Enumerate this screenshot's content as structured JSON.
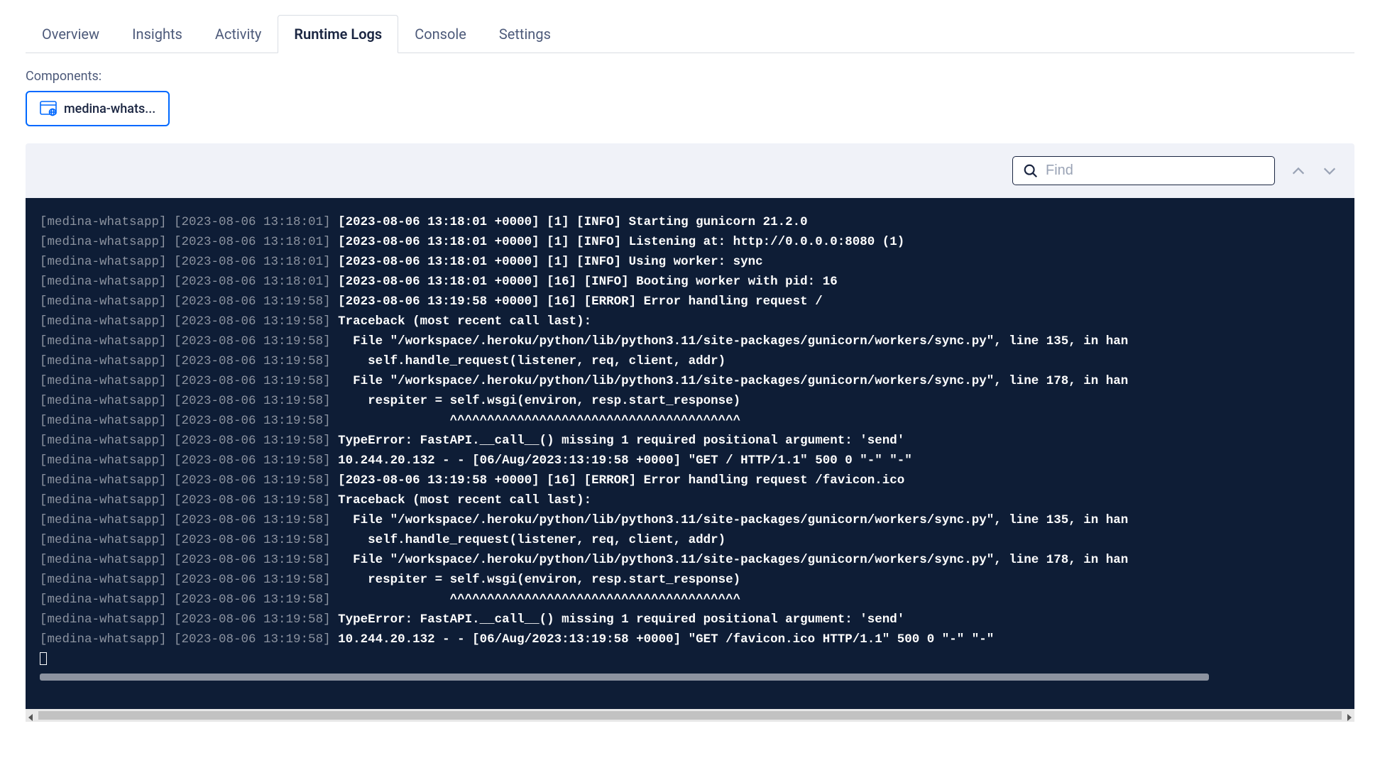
{
  "tabs": [
    {
      "label": "Overview",
      "active": false
    },
    {
      "label": "Insights",
      "active": false
    },
    {
      "label": "Activity",
      "active": false
    },
    {
      "label": "Runtime Logs",
      "active": true
    },
    {
      "label": "Console",
      "active": false
    },
    {
      "label": "Settings",
      "active": false
    }
  ],
  "components": {
    "label": "Components:",
    "selected": "medina-whats..."
  },
  "search": {
    "placeholder": "Find"
  },
  "logs": [
    {
      "prefix": "[medina-whatsapp]",
      "ts": "[2023-08-06 13:18:01]",
      "content": "[2023-08-06 13:18:01 +0000] [1] [INFO] Starting gunicorn 21.2.0"
    },
    {
      "prefix": "[medina-whatsapp]",
      "ts": "[2023-08-06 13:18:01]",
      "content": "[2023-08-06 13:18:01 +0000] [1] [INFO] Listening at: http://0.0.0.0:8080 (1)"
    },
    {
      "prefix": "[medina-whatsapp]",
      "ts": "[2023-08-06 13:18:01]",
      "content": "[2023-08-06 13:18:01 +0000] [1] [INFO] Using worker: sync"
    },
    {
      "prefix": "[medina-whatsapp]",
      "ts": "[2023-08-06 13:18:01]",
      "content": "[2023-08-06 13:18:01 +0000] [16] [INFO] Booting worker with pid: 16"
    },
    {
      "prefix": "[medina-whatsapp]",
      "ts": "[2023-08-06 13:19:58]",
      "content": "[2023-08-06 13:19:58 +0000] [16] [ERROR] Error handling request /"
    },
    {
      "prefix": "[medina-whatsapp]",
      "ts": "[2023-08-06 13:19:58]",
      "content": "Traceback (most recent call last):"
    },
    {
      "prefix": "[medina-whatsapp]",
      "ts": "[2023-08-06 13:19:58]",
      "content": "  File \"/workspace/.heroku/python/lib/python3.11/site-packages/gunicorn/workers/sync.py\", line 135, in han"
    },
    {
      "prefix": "[medina-whatsapp]",
      "ts": "[2023-08-06 13:19:58]",
      "content": "    self.handle_request(listener, req, client, addr)"
    },
    {
      "prefix": "[medina-whatsapp]",
      "ts": "[2023-08-06 13:19:58]",
      "content": "  File \"/workspace/.heroku/python/lib/python3.11/site-packages/gunicorn/workers/sync.py\", line 178, in han"
    },
    {
      "prefix": "[medina-whatsapp]",
      "ts": "[2023-08-06 13:19:58]",
      "content": "    respiter = self.wsgi(environ, resp.start_response)"
    },
    {
      "prefix": "[medina-whatsapp]",
      "ts": "[2023-08-06 13:19:58]",
      "content": "               ^^^^^^^^^^^^^^^^^^^^^^^^^^^^^^^^^^^^^^^"
    },
    {
      "prefix": "[medina-whatsapp]",
      "ts": "[2023-08-06 13:19:58]",
      "content": "TypeError: FastAPI.__call__() missing 1 required positional argument: 'send'"
    },
    {
      "prefix": "[medina-whatsapp]",
      "ts": "[2023-08-06 13:19:58]",
      "content": "10.244.20.132 - - [06/Aug/2023:13:19:58 +0000] \"GET / HTTP/1.1\" 500 0 \"-\" \"-\""
    },
    {
      "prefix": "[medina-whatsapp]",
      "ts": "[2023-08-06 13:19:58]",
      "content": "[2023-08-06 13:19:58 +0000] [16] [ERROR] Error handling request /favicon.ico"
    },
    {
      "prefix": "[medina-whatsapp]",
      "ts": "[2023-08-06 13:19:58]",
      "content": "Traceback (most recent call last):"
    },
    {
      "prefix": "[medina-whatsapp]",
      "ts": "[2023-08-06 13:19:58]",
      "content": "  File \"/workspace/.heroku/python/lib/python3.11/site-packages/gunicorn/workers/sync.py\", line 135, in han"
    },
    {
      "prefix": "[medina-whatsapp]",
      "ts": "[2023-08-06 13:19:58]",
      "content": "    self.handle_request(listener, req, client, addr)"
    },
    {
      "prefix": "[medina-whatsapp]",
      "ts": "[2023-08-06 13:19:58]",
      "content": "  File \"/workspace/.heroku/python/lib/python3.11/site-packages/gunicorn/workers/sync.py\", line 178, in han"
    },
    {
      "prefix": "[medina-whatsapp]",
      "ts": "[2023-08-06 13:19:58]",
      "content": "    respiter = self.wsgi(environ, resp.start_response)"
    },
    {
      "prefix": "[medina-whatsapp]",
      "ts": "[2023-08-06 13:19:58]",
      "content": "               ^^^^^^^^^^^^^^^^^^^^^^^^^^^^^^^^^^^^^^^"
    },
    {
      "prefix": "[medina-whatsapp]",
      "ts": "[2023-08-06 13:19:58]",
      "content": "TypeError: FastAPI.__call__() missing 1 required positional argument: 'send'"
    },
    {
      "prefix": "[medina-whatsapp]",
      "ts": "[2023-08-06 13:19:58]",
      "content": "10.244.20.132 - - [06/Aug/2023:13:19:58 +0000] \"GET /favicon.ico HTTP/1.1\" 500 0 \"-\" \"-\""
    }
  ]
}
